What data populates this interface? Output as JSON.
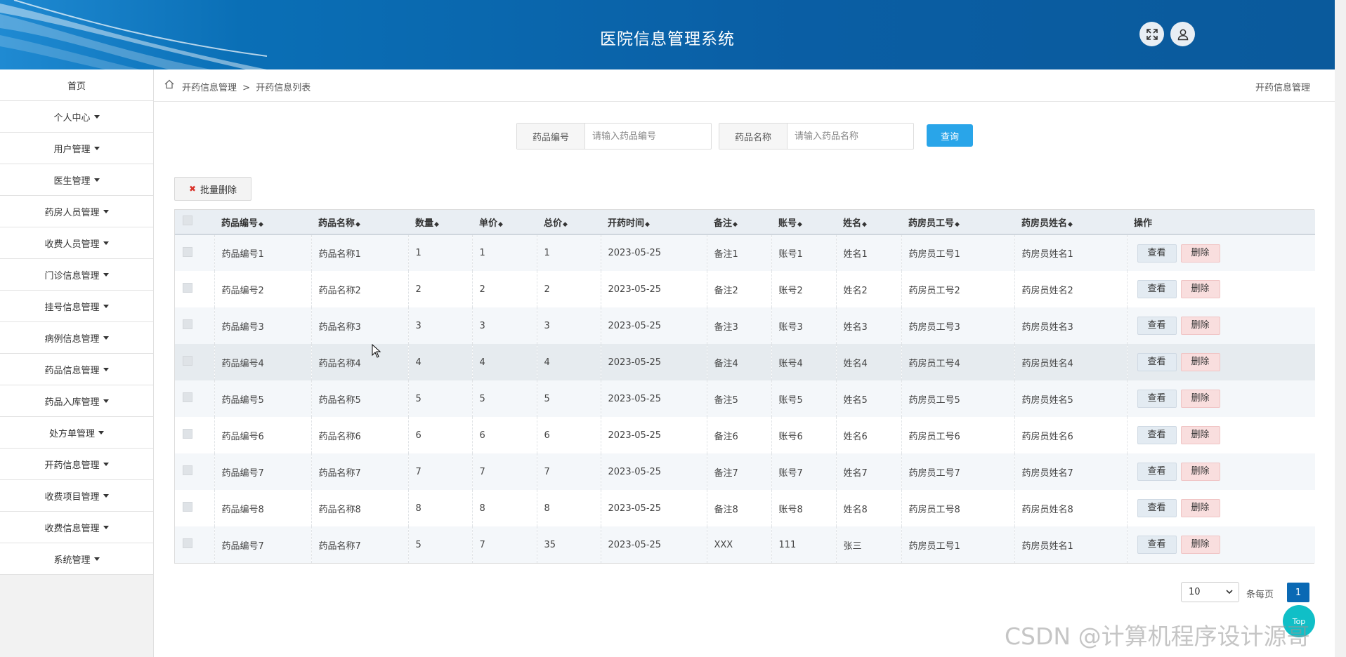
{
  "header": {
    "title": "医院信息管理系统",
    "fullscreen_icon": "fullscreen-icon",
    "user_icon": "user-icon"
  },
  "sidebar": {
    "items": [
      {
        "label": "首页",
        "has_caret": false
      },
      {
        "label": "个人中心",
        "has_caret": true
      },
      {
        "label": "用户管理",
        "has_caret": true
      },
      {
        "label": "医生管理",
        "has_caret": true
      },
      {
        "label": "药房人员管理",
        "has_caret": true
      },
      {
        "label": "收费人员管理",
        "has_caret": true
      },
      {
        "label": "门诊信息管理",
        "has_caret": true
      },
      {
        "label": "挂号信息管理",
        "has_caret": true
      },
      {
        "label": "病例信息管理",
        "has_caret": true
      },
      {
        "label": "药品信息管理",
        "has_caret": true
      },
      {
        "label": "药品入库管理",
        "has_caret": true
      },
      {
        "label": "处方单管理",
        "has_caret": true
      },
      {
        "label": "开药信息管理",
        "has_caret": true
      },
      {
        "label": "收费项目管理",
        "has_caret": true
      },
      {
        "label": "收费信息管理",
        "has_caret": true
      },
      {
        "label": "系统管理",
        "has_caret": true
      }
    ]
  },
  "breadcrumb": {
    "items": [
      "开药信息管理",
      ">",
      "开药信息列表"
    ],
    "right_title": "开药信息管理"
  },
  "search": {
    "field1_label": "药品编号",
    "field1_placeholder": "请输入药品编号",
    "field1_value": "",
    "field2_label": "药品名称",
    "field2_placeholder": "请输入药品名称",
    "field2_value": "",
    "query_label": "查询"
  },
  "actions": {
    "batch_delete_label": "批量删除"
  },
  "table": {
    "columns": [
      "药品编号",
      "药品名称",
      "数量",
      "单价",
      "总价",
      "开药时间",
      "备注",
      "账号",
      "姓名",
      "药房员工号",
      "药房员姓名",
      "操作"
    ],
    "view_label": "查看",
    "delete_label": "删除",
    "rows": [
      [
        "药品编号1",
        "药品名称1",
        "1",
        "1",
        "1",
        "2023-05-25",
        "备注1",
        "账号1",
        "姓名1",
        "药房员工号1",
        "药房员姓名1"
      ],
      [
        "药品编号2",
        "药品名称2",
        "2",
        "2",
        "2",
        "2023-05-25",
        "备注2",
        "账号2",
        "姓名2",
        "药房员工号2",
        "药房员姓名2"
      ],
      [
        "药品编号3",
        "药品名称3",
        "3",
        "3",
        "3",
        "2023-05-25",
        "备注3",
        "账号3",
        "姓名3",
        "药房员工号3",
        "药房员姓名3"
      ],
      [
        "药品编号4",
        "药品名称4",
        "4",
        "4",
        "4",
        "2023-05-25",
        "备注4",
        "账号4",
        "姓名4",
        "药房员工号4",
        "药房员姓名4"
      ],
      [
        "药品编号5",
        "药品名称5",
        "5",
        "5",
        "5",
        "2023-05-25",
        "备注5",
        "账号5",
        "姓名5",
        "药房员工号5",
        "药房员姓名5"
      ],
      [
        "药品编号6",
        "药品名称6",
        "6",
        "6",
        "6",
        "2023-05-25",
        "备注6",
        "账号6",
        "姓名6",
        "药房员工号6",
        "药房员姓名6"
      ],
      [
        "药品编号7",
        "药品名称7",
        "7",
        "7",
        "7",
        "2023-05-25",
        "备注7",
        "账号7",
        "姓名7",
        "药房员工号7",
        "药房员姓名7"
      ],
      [
        "药品编号8",
        "药品名称8",
        "8",
        "8",
        "8",
        "2023-05-25",
        "备注8",
        "账号8",
        "姓名8",
        "药房员工号8",
        "药房员姓名8"
      ],
      [
        "药品编号7",
        "药品名称7",
        "5",
        "7",
        "35",
        "2023-05-25",
        "XXX",
        "111",
        "张三",
        "药房员工号1",
        "药房员姓名1"
      ]
    ]
  },
  "pagination": {
    "page_size": "10",
    "per_page_label": "条每页",
    "current_page": "1"
  },
  "floating": {
    "top_label": "Top"
  },
  "watermark": "CSDN @计算机程序设计源哥",
  "colors": {
    "header_bg": "#0a5ea4",
    "query_btn": "#29a5e9",
    "page_active": "#0a69b4",
    "delete_btn": "#f9dede",
    "top_btn": "#10bfc7"
  }
}
